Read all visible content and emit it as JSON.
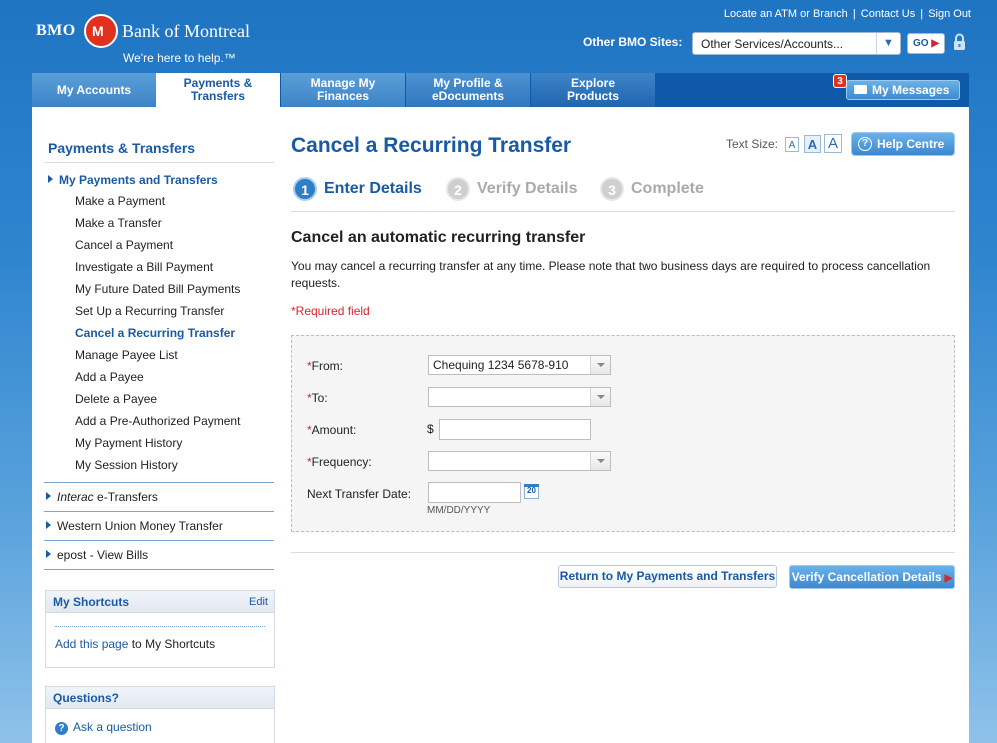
{
  "header": {
    "brand_short": "BMO",
    "roundel": "M",
    "brand_long": "Bank of Montreal",
    "tagline": "We're here to help.™",
    "top_links": [
      "Locate an ATM or Branch",
      "Contact Us",
      "Sign Out"
    ],
    "other_sites_label": "Other BMO Sites:",
    "other_sites_value": "Other Services/Accounts...",
    "go_label": "GO"
  },
  "nav": {
    "tabs": [
      {
        "label": "My Accounts"
      },
      {
        "label": "Payments & Transfers"
      },
      {
        "label": "Manage My Finances"
      },
      {
        "label": "My Profile & eDocuments"
      },
      {
        "label": "Explore Products"
      }
    ],
    "messages_count": "3",
    "messages_label": "My Messages"
  },
  "sidebar": {
    "title": "Payments & Transfers",
    "section_active": "My Payments and Transfers",
    "items": [
      "Make a Payment",
      "Make a Transfer",
      "Cancel a Payment",
      "Investigate a Bill Payment",
      "My Future Dated Bill Payments",
      "Set Up a Recurring Transfer",
      "Cancel a Recurring Transfer",
      "Manage Payee List",
      "Add a Payee",
      "Delete a Payee",
      "Add a Pre-Authorized Payment",
      "My Payment History",
      "My Session History"
    ],
    "active_item": "Cancel a Recurring Transfer",
    "sections": [
      {
        "prefix": "Interac",
        "label": " e-Transfers"
      },
      {
        "prefix": "",
        "label": "Western Union Money Transfer"
      },
      {
        "prefix": "",
        "label": "epost - View Bills"
      }
    ],
    "shortcuts": {
      "title": "My Shortcuts",
      "edit": "Edit",
      "add_link": "Add this page",
      "add_suffix": " to My Shortcuts"
    },
    "questions": {
      "title": "Questions?",
      "ask": "Ask a question"
    }
  },
  "content": {
    "title": "Cancel a Recurring Transfer",
    "text_size_label": "Text Size:",
    "text_size_options": [
      "A",
      "A",
      "A"
    ],
    "help_label": "Help Centre",
    "steps": [
      {
        "num": "1",
        "label": "Enter Details",
        "active": true
      },
      {
        "num": "2",
        "label": "Verify Details",
        "active": false
      },
      {
        "num": "3",
        "label": "Complete",
        "active": false
      }
    ],
    "heading": "Cancel an automatic recurring transfer",
    "description": "You may cancel a recurring transfer at any time. Please note that two business days are required to process cancellation requests.",
    "required_note": "Required field",
    "form": {
      "from_label": "From:",
      "from_value": "Chequing 1234 5678-910",
      "to_label": "To:",
      "to_value": "",
      "amount_label": "Amount:",
      "currency": "$",
      "amount_value": "",
      "frequency_label": "Frequency:",
      "frequency_value": "",
      "next_date_label": "Next Transfer Date:",
      "next_date_value": "",
      "calendar_day": "20",
      "date_format": "MM/DD/YYYY"
    },
    "buttons": {
      "return": "Return to My Payments and Transfers",
      "verify": "Verify Cancellation Details"
    }
  },
  "colors": {
    "brand_blue": "#1a5aa3",
    "brand_red": "#e0311f",
    "required_red": "#d9232e"
  }
}
